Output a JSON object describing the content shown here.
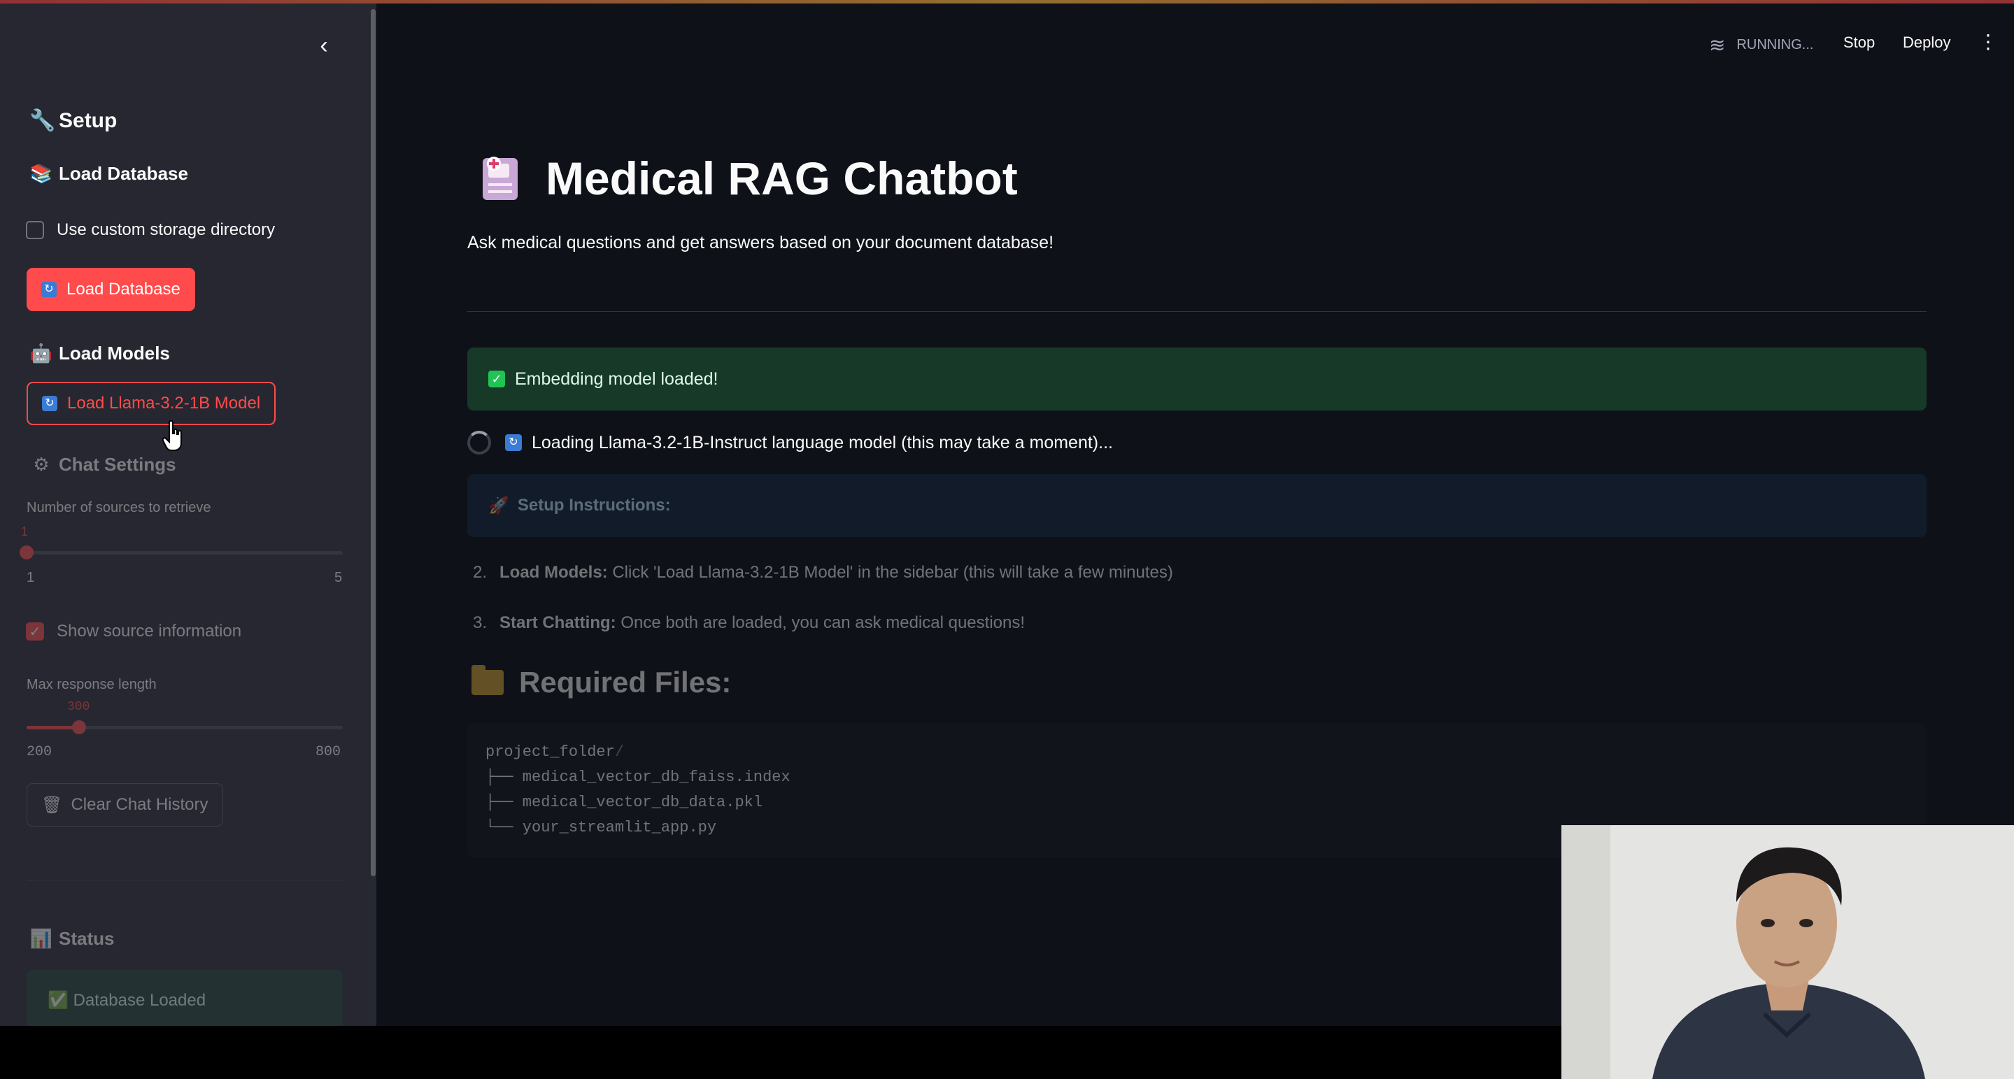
{
  "sidebar": {
    "collapse_icon": "chevron-left-icon",
    "setup_heading": "Setup",
    "load_database_heading": "Load Database",
    "custom_storage_label": "Use custom storage directory",
    "custom_storage_checked": false,
    "load_database_button": "Load Database",
    "load_models_heading": "Load Models",
    "load_model_button": "Load Llama-3.2-1B Model",
    "chat_settings_heading": "Chat Settings",
    "sources_slider": {
      "label": "Number of sources to retrieve",
      "value": "1",
      "min": "1",
      "max": "5",
      "fraction": 0.0
    },
    "show_source_label": "Show source information",
    "show_source_checked": true,
    "length_slider": {
      "label": "Max response length",
      "value": "300",
      "min": "200",
      "max": "800",
      "fraction": 0.1667
    },
    "clear_history_button": "Clear Chat History",
    "status_heading": "Status",
    "status_database": "Database Loaded"
  },
  "header": {
    "running_label": "RUNNING...",
    "stop_label": "Stop",
    "deploy_label": "Deploy",
    "menu_icon": "kebab-menu-icon"
  },
  "main": {
    "title": "Medical RAG Chatbot",
    "subtitle": "Ask medical questions and get answers based on your document database!",
    "success_message": "Embedding model loaded!",
    "loading_message": "Loading Llama-3.2-1B-Instruct language model (this may take a moment)...",
    "setup_instructions_title": "Setup Instructions:",
    "steps": [
      {
        "num": "2.",
        "bold": "Load Models:",
        "text": " Click 'Load Llama-3.2-1B Model' in the sidebar (this will take a few minutes)"
      },
      {
        "num": "3.",
        "bold": "Start Chatting:",
        "text": " Once both are loaded, you can ask medical questions!"
      }
    ],
    "required_files_title": "Required Files:",
    "code_lines": [
      {
        "a": "project_folder",
        "b": "/"
      },
      {
        "a": "├── medical_vector_db_faiss.index",
        "b": ""
      },
      {
        "a": "├── medical_vector_db_data.pkl",
        "b": ""
      },
      {
        "a": "└── your_streamlit_app.py",
        "b": ""
      }
    ]
  },
  "colors": {
    "primary": "#ff4b4b",
    "background": "#0e1117",
    "sidebar": "#262730",
    "success_bg": "#173928",
    "info_bg": "#172d43"
  }
}
